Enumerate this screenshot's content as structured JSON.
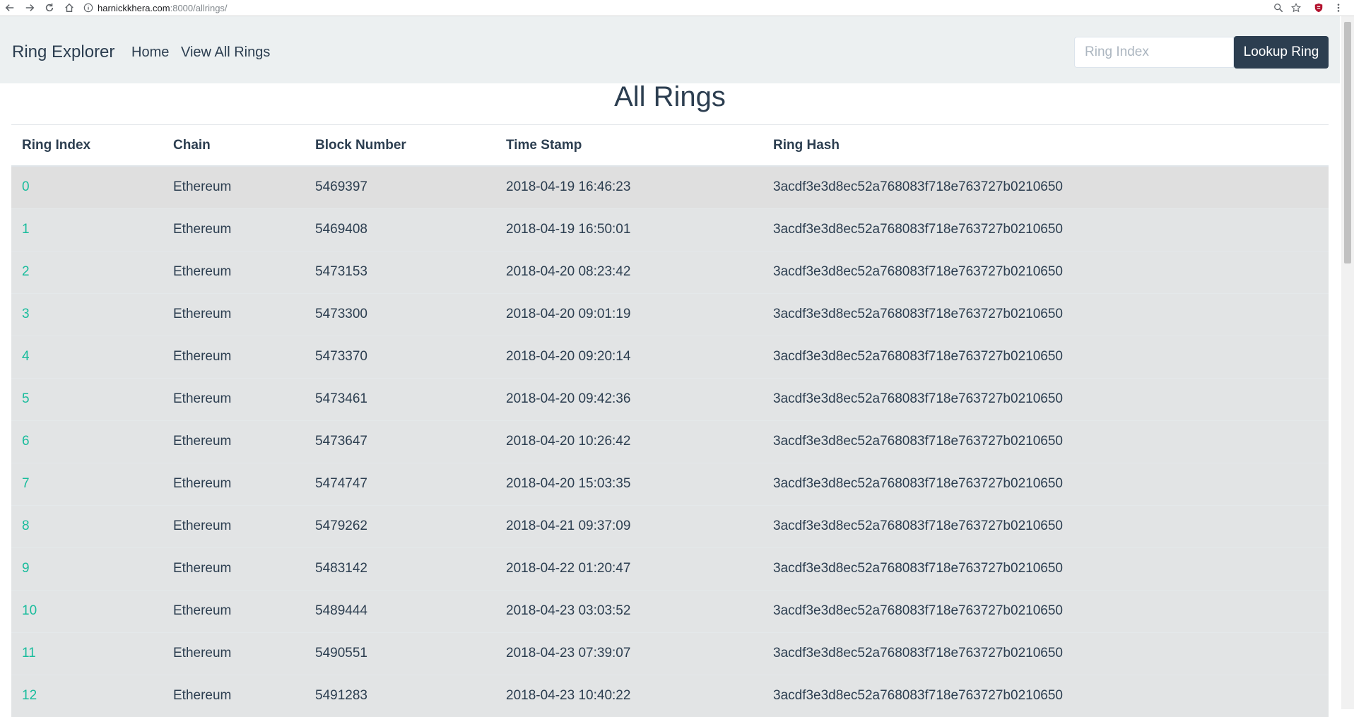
{
  "browser": {
    "url_host": "harnickkhera.com",
    "url_path": ":8000/allrings/",
    "icons": [
      "back-icon",
      "forward-icon",
      "reload-icon",
      "home-icon",
      "info-icon",
      "zoom-icon",
      "star-icon",
      "extension-icon",
      "menu-icon"
    ]
  },
  "navbar": {
    "brand": "Ring Explorer",
    "links": [
      "Home",
      "View All Rings"
    ],
    "search_placeholder": "Ring Index",
    "lookup_label": "Lookup Ring"
  },
  "main": {
    "title": "All Rings",
    "columns": [
      "Ring Index",
      "Chain",
      "Block Number",
      "Time Stamp",
      "Ring Hash"
    ],
    "rows": [
      {
        "index": "0",
        "chain": "Ethereum",
        "block": "5469397",
        "time": "2018-04-19 16:46:23",
        "hash": "3acdf3e3d8ec52a768083f718e763727b0210650"
      },
      {
        "index": "1",
        "chain": "Ethereum",
        "block": "5469408",
        "time": "2018-04-19 16:50:01",
        "hash": "3acdf3e3d8ec52a768083f718e763727b0210650"
      },
      {
        "index": "2",
        "chain": "Ethereum",
        "block": "5473153",
        "time": "2018-04-20 08:23:42",
        "hash": "3acdf3e3d8ec52a768083f718e763727b0210650"
      },
      {
        "index": "3",
        "chain": "Ethereum",
        "block": "5473300",
        "time": "2018-04-20 09:01:19",
        "hash": "3acdf3e3d8ec52a768083f718e763727b0210650"
      },
      {
        "index": "4",
        "chain": "Ethereum",
        "block": "5473370",
        "time": "2018-04-20 09:20:14",
        "hash": "3acdf3e3d8ec52a768083f718e763727b0210650"
      },
      {
        "index": "5",
        "chain": "Ethereum",
        "block": "5473461",
        "time": "2018-04-20 09:42:36",
        "hash": "3acdf3e3d8ec52a768083f718e763727b0210650"
      },
      {
        "index": "6",
        "chain": "Ethereum",
        "block": "5473647",
        "time": "2018-04-20 10:26:42",
        "hash": "3acdf3e3d8ec52a768083f718e763727b0210650"
      },
      {
        "index": "7",
        "chain": "Ethereum",
        "block": "5474747",
        "time": "2018-04-20 15:03:35",
        "hash": "3acdf3e3d8ec52a768083f718e763727b0210650"
      },
      {
        "index": "8",
        "chain": "Ethereum",
        "block": "5479262",
        "time": "2018-04-21 09:37:09",
        "hash": "3acdf3e3d8ec52a768083f718e763727b0210650"
      },
      {
        "index": "9",
        "chain": "Ethereum",
        "block": "5483142",
        "time": "2018-04-22 01:20:47",
        "hash": "3acdf3e3d8ec52a768083f718e763727b0210650"
      },
      {
        "index": "10",
        "chain": "Ethereum",
        "block": "5489444",
        "time": "2018-04-23 03:03:52",
        "hash": "3acdf3e3d8ec52a768083f718e763727b0210650"
      },
      {
        "index": "11",
        "chain": "Ethereum",
        "block": "5490551",
        "time": "2018-04-23 07:39:07",
        "hash": "3acdf3e3d8ec52a768083f718e763727b0210650"
      },
      {
        "index": "12",
        "chain": "Ethereum",
        "block": "5491283",
        "time": "2018-04-23 10:40:22",
        "hash": "3acdf3e3d8ec52a768083f718e763727b0210650"
      }
    ]
  },
  "colors": {
    "primary": "#2c3e50",
    "accent_link": "#18bc9c",
    "navbar_bg": "#ecf0f1",
    "row_bg": "#e2e4e5",
    "first_row_bg": "#dfdfdf"
  }
}
